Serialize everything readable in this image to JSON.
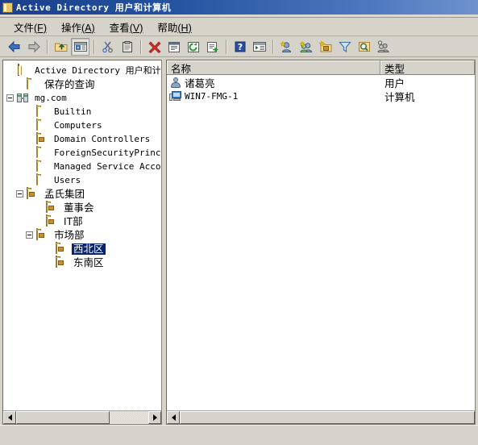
{
  "window": {
    "title": "Active Directory 用户和计算机",
    "icon": "console-snapin-icon"
  },
  "menubar": {
    "items": [
      {
        "label": "文件",
        "accel": "(F)"
      },
      {
        "label": "操作",
        "accel": "(A)"
      },
      {
        "label": "查看",
        "accel": "(V)"
      },
      {
        "label": "帮助",
        "accel": "(H)"
      }
    ]
  },
  "toolbar": {
    "buttons": [
      {
        "name": "back-icon",
        "tip": "后退"
      },
      {
        "name": "forward-icon",
        "tip": "前进"
      },
      {
        "name": "up-one-level-icon",
        "tip": "上一级"
      },
      {
        "name": "show-hide-tree-icon",
        "tip": "显示/隐藏控制台树"
      },
      {
        "name": "cut-icon",
        "tip": "剪切"
      },
      {
        "name": "paste-icon",
        "tip": "粘贴"
      },
      {
        "name": "delete-icon",
        "tip": "删除"
      },
      {
        "name": "properties-icon",
        "tip": "属性"
      },
      {
        "name": "refresh-icon",
        "tip": "刷新"
      },
      {
        "name": "export-list-icon",
        "tip": "导出列表"
      },
      {
        "name": "help-icon",
        "tip": "帮助"
      },
      {
        "name": "show-action-pane-icon",
        "tip": "显示操作窗格"
      },
      {
        "name": "new-user-icon",
        "tip": "新建用户"
      },
      {
        "name": "new-group-icon",
        "tip": "新建组"
      },
      {
        "name": "new-container-icon",
        "tip": "新建组织单位"
      },
      {
        "name": "filter-icon",
        "tip": "筛选"
      },
      {
        "name": "find-icon",
        "tip": "查找"
      },
      {
        "name": "find-users-icon",
        "tip": "查找用户、联系人和组"
      }
    ]
  },
  "tree": {
    "nodes": [
      {
        "label": "Active Directory 用户和计算机",
        "icon": "console-snapin-icon",
        "indent": 0,
        "expander": "none",
        "selected": false,
        "cjk": false
      },
      {
        "label": "保存的查询",
        "icon": "folder-icon",
        "indent": 1,
        "expander": "none",
        "selected": false,
        "cjk": true
      },
      {
        "label": "mg.com",
        "icon": "domain-icon",
        "indent": 0,
        "expander": "expanded",
        "selected": false,
        "cjk": false
      },
      {
        "label": "Builtin",
        "icon": "folder-icon",
        "indent": 2,
        "expander": "none",
        "selected": false,
        "cjk": false
      },
      {
        "label": "Computers",
        "icon": "folder-icon",
        "indent": 2,
        "expander": "none",
        "selected": false,
        "cjk": false
      },
      {
        "label": "Domain Controllers",
        "icon": "ou-folder-icon",
        "indent": 2,
        "expander": "none",
        "selected": false,
        "cjk": false
      },
      {
        "label": "ForeignSecurityPrincip",
        "icon": "folder-icon",
        "indent": 2,
        "expander": "none",
        "selected": false,
        "cjk": false
      },
      {
        "label": "Managed Service Accoun",
        "icon": "folder-icon",
        "indent": 2,
        "expander": "none",
        "selected": false,
        "cjk": false
      },
      {
        "label": "Users",
        "icon": "folder-icon",
        "indent": 2,
        "expander": "none",
        "selected": false,
        "cjk": false
      },
      {
        "label": "孟氏集团",
        "icon": "ou-folder-icon",
        "indent": 1,
        "expander": "expanded",
        "selected": false,
        "cjk": true
      },
      {
        "label": "董事会",
        "icon": "ou-folder-icon",
        "indent": 3,
        "expander": "none",
        "selected": false,
        "cjk": true
      },
      {
        "label": "IT部",
        "icon": "ou-folder-icon",
        "indent": 3,
        "expander": "none",
        "selected": false,
        "cjk": true
      },
      {
        "label": "市场部",
        "icon": "ou-folder-icon",
        "indent": 2,
        "expander": "expanded",
        "selected": false,
        "cjk": true
      },
      {
        "label": "西北区",
        "icon": "ou-folder-icon",
        "indent": 4,
        "expander": "none",
        "selected": true,
        "cjk": true
      },
      {
        "label": "东南区",
        "icon": "ou-folder-icon",
        "indent": 4,
        "expander": "none",
        "selected": false,
        "cjk": true
      }
    ]
  },
  "list": {
    "columns": [
      {
        "label": "名称"
      },
      {
        "label": "类型"
      }
    ],
    "rows": [
      {
        "name": "诸葛亮",
        "type": "用户",
        "icon": "user-icon",
        "cjk": true
      },
      {
        "name": "WIN7-FMG-1",
        "type": "计算机",
        "icon": "computer-icon",
        "cjk": false
      }
    ]
  },
  "colors": {
    "title_start": "#1b3f8b",
    "title_end": "#6f92cd",
    "selection": "#0a246a",
    "chrome": "#d6d3cb",
    "pane": "#ffffff"
  }
}
